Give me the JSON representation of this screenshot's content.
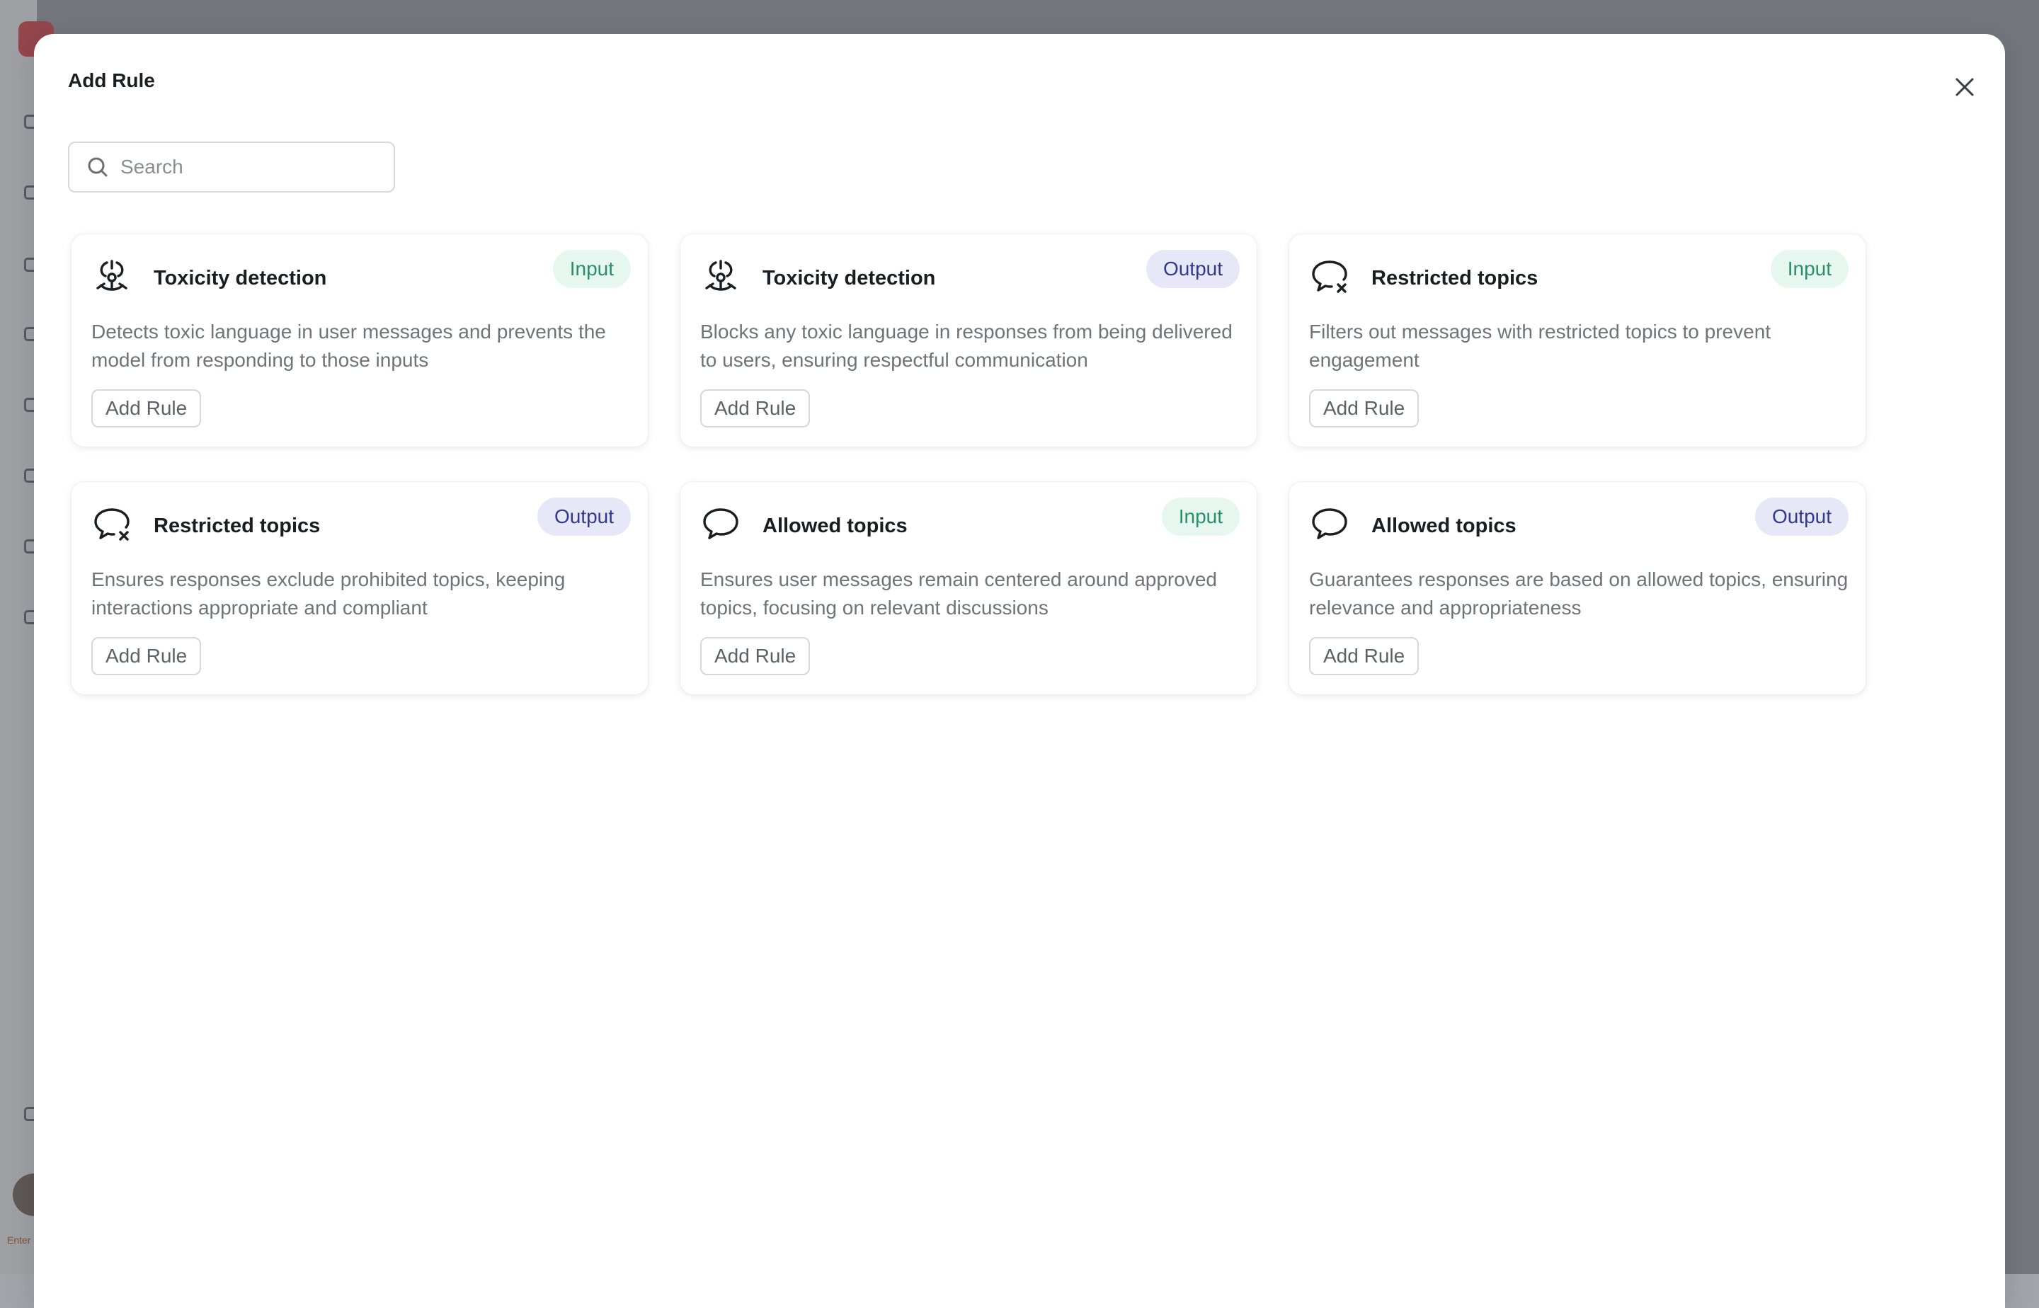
{
  "background": {
    "sidebar_label": "Enter"
  },
  "modal": {
    "title": "Add Rule",
    "close_icon": "close-icon",
    "search": {
      "placeholder": "Search",
      "value": "",
      "icon": "search-icon"
    }
  },
  "cards": [
    {
      "icon": "biohazard-icon",
      "title": "Toxicity detection",
      "badge": "Input",
      "badge_type": "input",
      "description": "Detects toxic language in user messages and prevents the model from responding to those inputs",
      "button": "Add Rule"
    },
    {
      "icon": "biohazard-icon",
      "title": "Toxicity detection",
      "badge": "Output",
      "badge_type": "output",
      "description": "Blocks any toxic language in responses from being delivered to users, ensuring respectful communication",
      "button": "Add Rule"
    },
    {
      "icon": "speech-bubble-x-icon",
      "title": "Restricted topics",
      "badge": "Input",
      "badge_type": "input",
      "description": "Filters out messages with restricted topics to prevent engagement",
      "button": "Add Rule"
    },
    {
      "icon": "speech-bubble-x-icon",
      "title": "Restricted topics",
      "badge": "Output",
      "badge_type": "output",
      "description": "Ensures responses exclude prohibited topics, keeping interactions appropriate and compliant",
      "button": "Add Rule"
    },
    {
      "icon": "speech-bubble-icon",
      "title": "Allowed topics",
      "badge": "Input",
      "badge_type": "input",
      "description": "Ensures user messages remain centered around approved topics, focusing on relevant discussions",
      "button": "Add Rule"
    },
    {
      "icon": "speech-bubble-icon",
      "title": "Allowed topics",
      "badge": "Output",
      "badge_type": "output",
      "description": "Guarantees responses are based on allowed topics, ensuring relevance and appropriateness",
      "button": "Add Rule"
    }
  ],
  "colors": {
    "input_badge_bg": "#e6f7f0",
    "input_badge_text": "#2a8f68",
    "output_badge_bg": "#e6e8f7",
    "output_badge_text": "#333a8c"
  }
}
